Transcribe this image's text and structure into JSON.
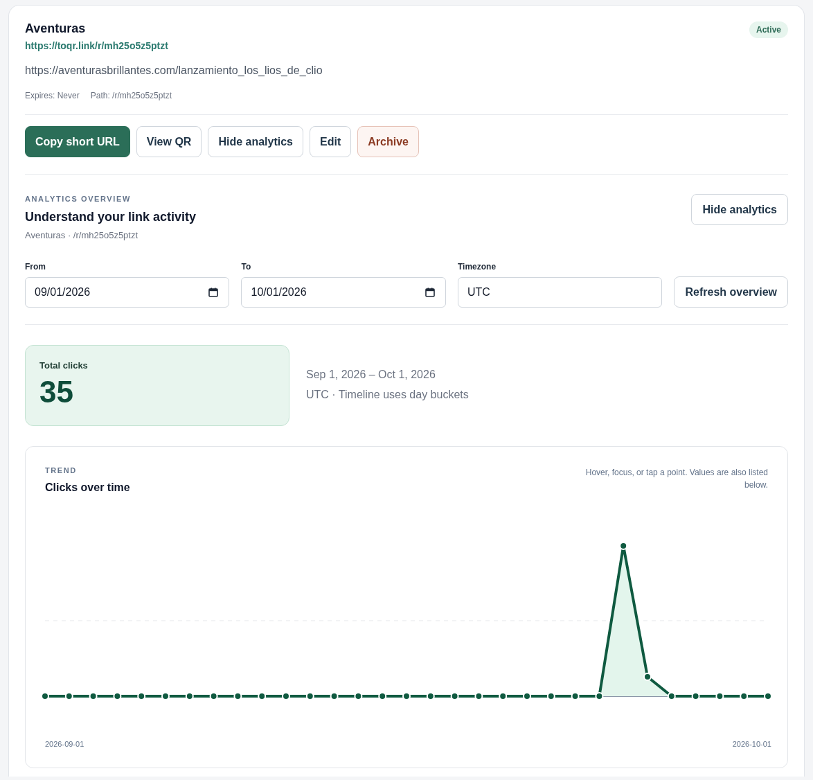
{
  "link": {
    "title": "Aventuras",
    "short_url": "https://toqr.link/r/mh25o5z5ptzt",
    "destination": "https://aventurasbrillantes.com/lanzamiento_los_lios_de_clio",
    "meta": [
      "Expires: Never",
      "Path: /r/mh25o5z5ptzt"
    ],
    "status": {
      "label": "Active",
      "kind": "active"
    }
  },
  "actions": [
    {
      "label": "Copy short URL",
      "kind": "primary"
    },
    {
      "label": "View QR",
      "kind": "default"
    },
    {
      "label": "Hide analytics",
      "kind": "default"
    },
    {
      "label": "Edit",
      "kind": "default"
    },
    {
      "label": "Archive",
      "kind": "danger"
    }
  ],
  "analytics": {
    "eyebrow": "ANALYTICS OVERVIEW",
    "title": "Understand your link activity",
    "subtitle": "Aventuras · /r/mh25o5z5ptzt",
    "toggle_button": "Hide analytics",
    "filters": [
      {
        "label": "From",
        "value": "09/01/2026",
        "kind": "date"
      },
      {
        "label": "To",
        "value": "10/01/2026",
        "kind": "date"
      },
      {
        "label": "Timezone",
        "value": "UTC",
        "kind": "text"
      }
    ],
    "refresh_button": "Refresh overview",
    "total": {
      "label": "Total clicks",
      "value": "35"
    },
    "range_lines": [
      "Sep 1, 2026 – Oct 1, 2026",
      "UTC · Timeline uses day buckets"
    ],
    "trend": {
      "eyebrow": "TREND",
      "title": "Clicks over time",
      "hint": "Hover, focus, or tap a point. Values are also listed below.",
      "x_labels": [
        "2026-09-01",
        "2026-10-01"
      ]
    }
  }
}
